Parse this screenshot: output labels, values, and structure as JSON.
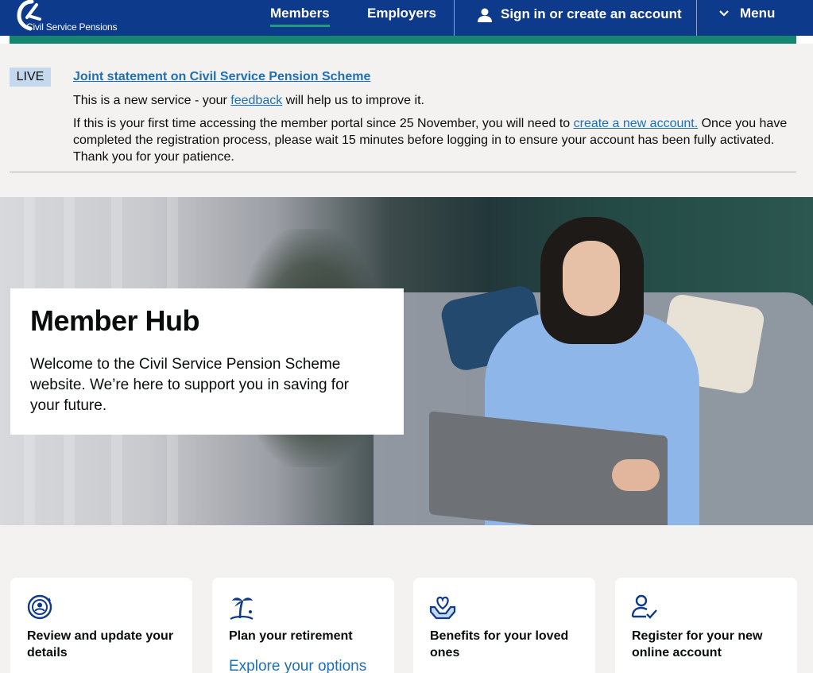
{
  "header": {
    "logo_text": "Civil Service Pensions",
    "nav": {
      "members": "Members",
      "employers": "Employers",
      "sign_in": "Sign in or create an account",
      "menu": "Menu"
    }
  },
  "notice": {
    "tag": "LIVE",
    "title_link": "Joint statement on Civil Service Pension Scheme",
    "line1_prefix": "This is a new service - your ",
    "line1_link": "feedback",
    "line1_suffix": " will help us to improve it.",
    "line2_prefix": "If this is your first time accessing the member portal since 25 November, you will need to ",
    "line2_link": "create a new account.",
    "line2_suffix": " Once you have completed the registration process, please wait 15 minutes before logging in to ensure your account has been fully activated. Thank you for your patience."
  },
  "hero": {
    "title": "Member Hub",
    "text": "Welcome to the Civil Service Pension Scheme website. We’re here to support you in saving for your future."
  },
  "cards": [
    {
      "icon": "person-refresh-icon",
      "title": "Review and update your details",
      "link": ""
    },
    {
      "icon": "palm-tree-icon",
      "title": "Plan your retirement",
      "link": "Explore your options"
    },
    {
      "icon": "heart-hands-icon",
      "title": "Benefits for your loved ones",
      "link": ""
    },
    {
      "icon": "person-check-icon",
      "title": "Register for your new online account",
      "link": ""
    }
  ],
  "colors": {
    "header_bg": "#0d3a8a",
    "accent_teal": "#14876e",
    "link_blue": "#1d70b8",
    "live_tag_bg": "#c4d9ee",
    "notice_bg": "#f3f2f1"
  }
}
